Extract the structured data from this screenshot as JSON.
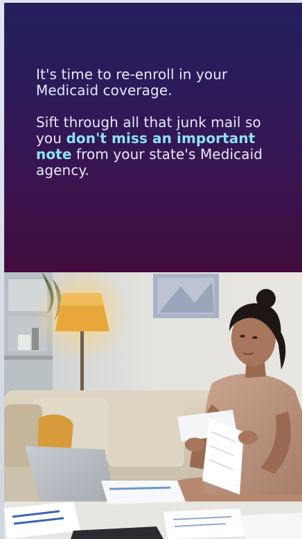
{
  "message": {
    "line1": "It's time to re-enroll in your Medicaid coverage.",
    "line2_start": "Sift through all that junk mail so you ",
    "line2_highlight": "don't miss an important note",
    "line2_end": " from your state's Medicaid agency."
  },
  "colors": {
    "panel_top": "#23205c",
    "panel_bottom": "#420c3c",
    "text": "#e6e9f6",
    "highlight": "#8de3ef"
  },
  "photo": {
    "subject": "woman-reading-mail-on-couch"
  }
}
